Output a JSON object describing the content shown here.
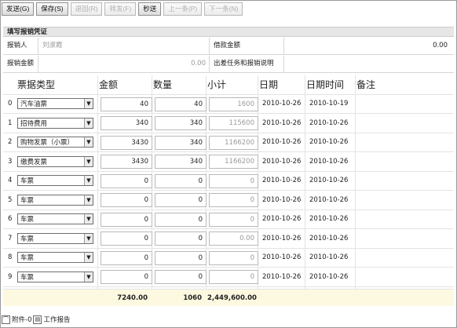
{
  "toolbar": {
    "buttons": [
      {
        "label": "发送(G)",
        "enabled": true
      },
      {
        "label": "保存(S)",
        "enabled": true
      },
      {
        "label": "退回(R)",
        "enabled": false
      },
      {
        "label": "转发(F)",
        "enabled": false
      },
      {
        "label": "秒送",
        "enabled": true
      },
      {
        "label": "上一条(P)",
        "enabled": false
      },
      {
        "label": "下一条(N)",
        "enabled": false
      }
    ]
  },
  "form": {
    "title": "填写报销凭证",
    "reporter_label": "报销人",
    "reporter_value": "刘淑霞",
    "loan_label": "借款金额",
    "loan_value": "0.00",
    "reimburse_label": "报销金额",
    "reimburse_value": "0.00",
    "note_label": "出差任务和报销说明"
  },
  "grid": {
    "headers": [
      "票据类型",
      "金额",
      "数量",
      "小计",
      "日期",
      "日期时间",
      "备注"
    ],
    "rows": [
      {
        "idx": "0",
        "type": "汽车油票",
        "amount": "40",
        "qty": "40",
        "subtotal": "1600",
        "date": "2010-10-26",
        "datetime": "2010-10-19",
        "note": ""
      },
      {
        "idx": "1",
        "type": "招待费用",
        "amount": "340",
        "qty": "340",
        "subtotal": "115600",
        "date": "2010-10-26",
        "datetime": "2010-10-26",
        "note": ""
      },
      {
        "idx": "2",
        "type": "购物发票（小票）",
        "amount": "3430",
        "qty": "340",
        "subtotal": "1166200",
        "date": "2010-10-26",
        "datetime": "2010-10-26",
        "note": ""
      },
      {
        "idx": "3",
        "type": "缴费发票",
        "amount": "3430",
        "qty": "340",
        "subtotal": "1166200",
        "date": "2010-10-26",
        "datetime": "2010-10-26",
        "note": ""
      },
      {
        "idx": "4",
        "type": "车票",
        "amount": "0",
        "qty": "0",
        "subtotal": "0",
        "date": "2010-10-26",
        "datetime": "2010-10-26",
        "note": ""
      },
      {
        "idx": "5",
        "type": "车票",
        "amount": "0",
        "qty": "0",
        "subtotal": "0",
        "date": "2010-10-26",
        "datetime": "2010-10-26",
        "note": ""
      },
      {
        "idx": "6",
        "type": "车票",
        "amount": "0",
        "qty": "0",
        "subtotal": "0",
        "date": "2010-10-26",
        "datetime": "2010-10-26",
        "note": ""
      },
      {
        "idx": "7",
        "type": "车票",
        "amount": "0",
        "qty": "0",
        "subtotal": "0.00",
        "date": "2010-10-26",
        "datetime": "2010-10-26",
        "note": ""
      },
      {
        "idx": "8",
        "type": "车票",
        "amount": "0",
        "qty": "0",
        "subtotal": "0",
        "date": "2010-10-26",
        "datetime": "2010-10-26",
        "note": ""
      },
      {
        "idx": "9",
        "type": "车票",
        "amount": "0",
        "qty": "0",
        "subtotal": "0",
        "date": "2010-10-26",
        "datetime": "2010-10-26",
        "note": ""
      }
    ],
    "totals": {
      "amount": "7240.00",
      "qty": "1060",
      "subtotal": "2,449,600.00"
    }
  },
  "footer": {
    "attachment": "附件-0",
    "report": "工作报告"
  },
  "icons": {
    "dropdown": "chevron-down-icon",
    "attachment": "paperclip-icon",
    "report": "document-icon"
  }
}
